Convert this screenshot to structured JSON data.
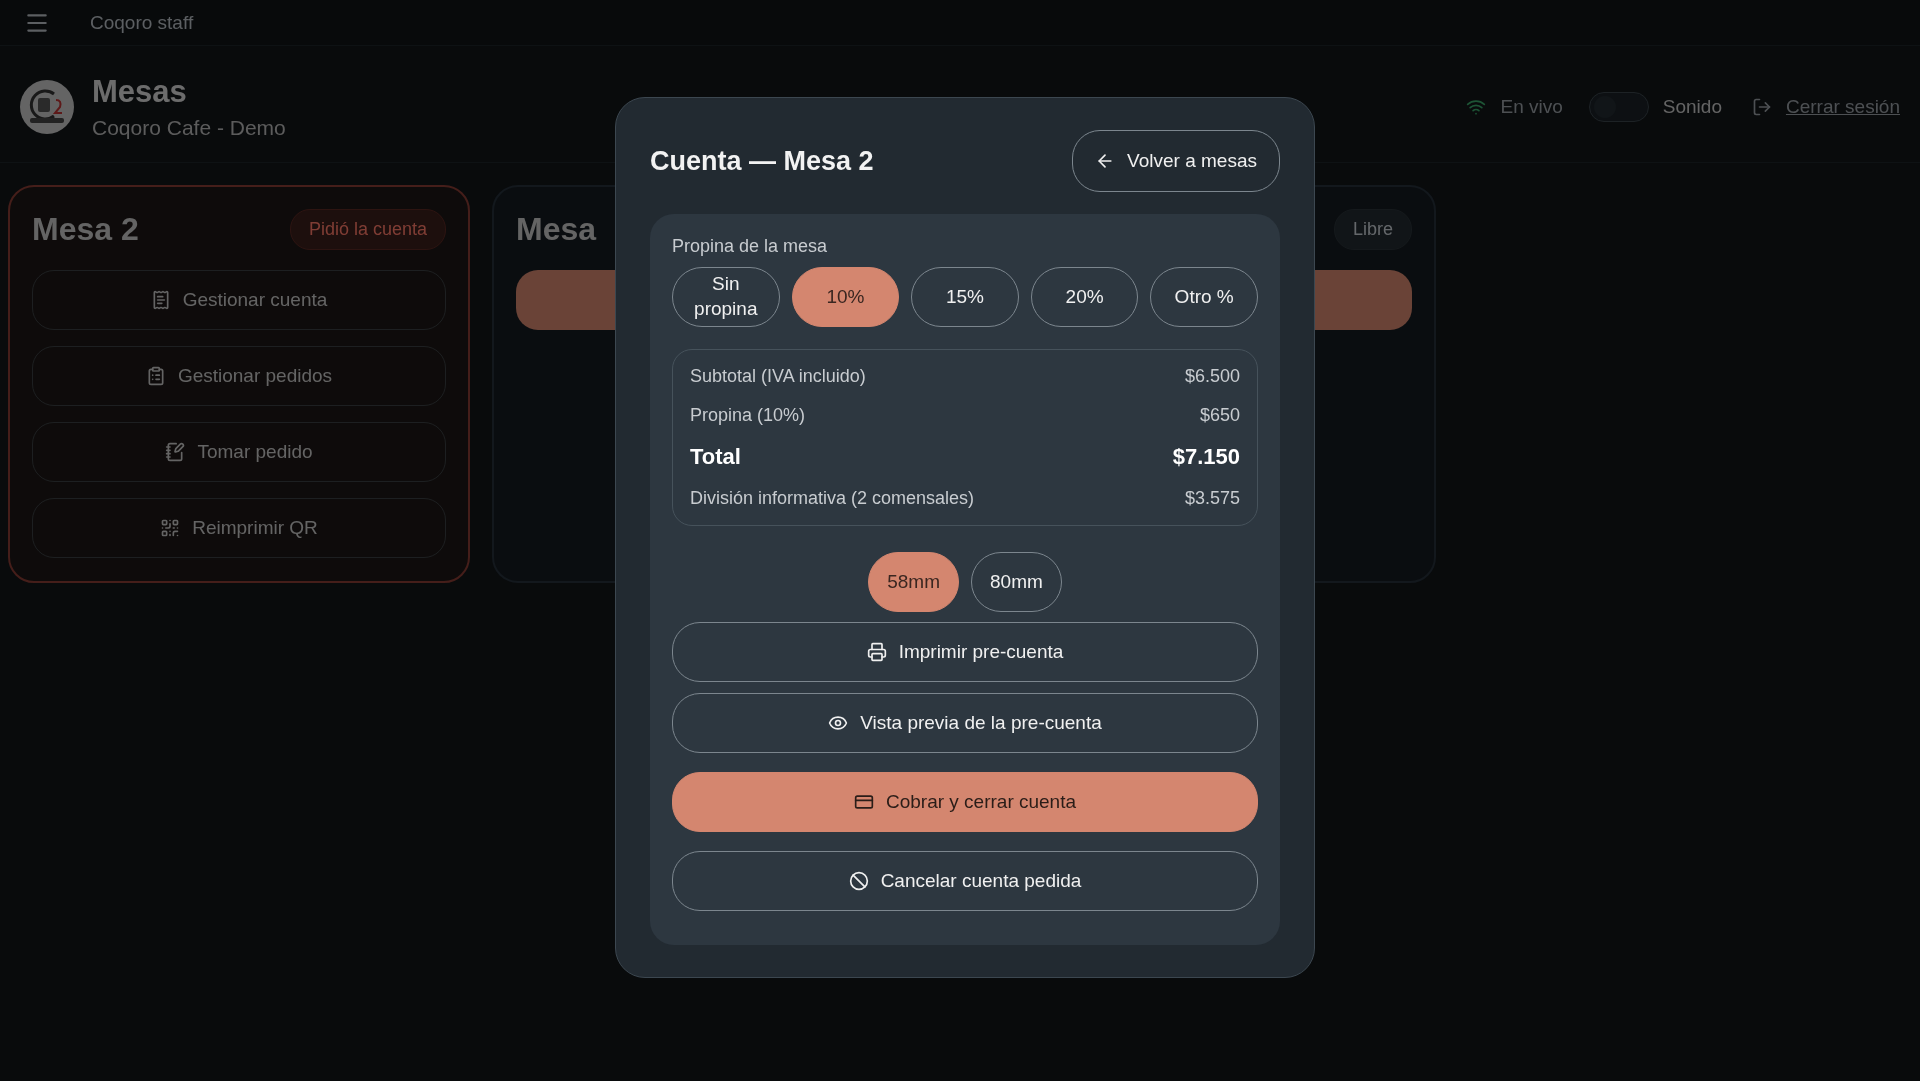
{
  "app_bar": {
    "title": "Coqoro staff"
  },
  "header": {
    "title": "Mesas",
    "subtitle": "Coqoro Cafe - Demo",
    "status": "En vivo",
    "sound": {
      "label": "Sonido",
      "on": false
    },
    "logout": "Cerrar sesión"
  },
  "tables": [
    {
      "name": "Mesa 2",
      "status": "Pidió la cuenta",
      "kind": "requested",
      "actions": [
        {
          "label": "Gestionar cuenta"
        },
        {
          "label": "Gestionar pedidos"
        },
        {
          "label": "Tomar pedido"
        },
        {
          "label": "Reimprimir QR"
        }
      ]
    },
    {
      "name": "Mesa",
      "status": "Libre",
      "kind": "free"
    }
  ],
  "modal": {
    "title": "Cuenta — Mesa 2",
    "back_button": "Volver a mesas",
    "tip": {
      "label": "Propina de la mesa",
      "options": [
        {
          "label": "Sin propina",
          "selected": false
        },
        {
          "label": "10%",
          "selected": true
        },
        {
          "label": "15%",
          "selected": false
        },
        {
          "label": "20%",
          "selected": false
        },
        {
          "label": "Otro %",
          "selected": false
        }
      ]
    },
    "summary": [
      {
        "label": "Subtotal (IVA incluido)",
        "value": "$6.500",
        "kind": "line"
      },
      {
        "label": "Propina (10%)",
        "value": "$650",
        "kind": "line"
      },
      {
        "label": "Total",
        "value": "$7.150",
        "kind": "total"
      },
      {
        "label": "División informativa (2 comensales)",
        "value": "$3.575",
        "kind": "line"
      }
    ],
    "paper_sizes": [
      {
        "label": "58mm",
        "selected": true
      },
      {
        "label": "80mm",
        "selected": false
      }
    ],
    "actions": [
      {
        "label": "Imprimir pre-cuenta",
        "kind": "outline"
      },
      {
        "label": "Vista previa de la pre-cuenta",
        "kind": "outline"
      },
      {
        "label": "Cobrar y cerrar cuenta",
        "kind": "primary"
      },
      {
        "label": "Cancelar cuenta pedida",
        "kind": "outline"
      }
    ]
  }
}
